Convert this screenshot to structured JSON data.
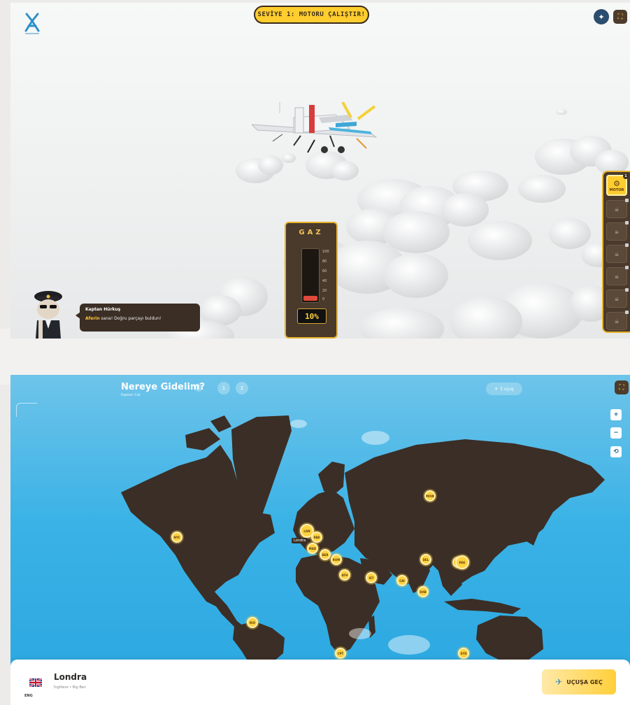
{
  "game": {
    "level_banner": "SEVİYE 1: MOTORU ÇALIŞTIR!",
    "throttle": {
      "label": "GAZ",
      "level": 0.1,
      "readout": "10%",
      "ticks": [
        "100",
        "80",
        "60",
        "40",
        "20",
        "0"
      ]
    },
    "parts_rail": {
      "active_label": "MOTOR",
      "active_badge": "1",
      "locked_count": 6
    },
    "pilot": {
      "name": "Kaptan Hürkuş",
      "message_highlight": "Aferin",
      "message_rest": " sana! Doğru parçayı buldun!"
    },
    "icons": {
      "top_right_round": "plus-icon",
      "top_right_square": "fullscreen-icon",
      "rail_active": "gear-icon",
      "rail_locked": "lock-icon"
    },
    "colors": {
      "accent": "#ffcd2e",
      "panel": "#4a3a2c",
      "throttle_fill": "#e04a3a"
    }
  },
  "map": {
    "title": "Nereye Gidelim?",
    "subtitle": "Kaptan Cat",
    "info_label": "i",
    "steps": [
      "1",
      "2"
    ],
    "plane_count": "3 uçuş",
    "zoom": {
      "in": "+",
      "out": "−",
      "reset": "⟲"
    },
    "selected_label": "Londra",
    "markers": [
      "LDN",
      "PAR",
      "ROM",
      "IST",
      "CAI",
      "DXB",
      "DEL",
      "BKK",
      "PEK",
      "TYO",
      "MOW",
      "NYC",
      "RIO",
      "CPT",
      "SYD",
      "MAD",
      "BER",
      "ATH"
    ],
    "destination": {
      "name": "Londra",
      "description": "İngiltere • Big Ben",
      "code": "ENG",
      "go_button": "UÇUŞA GEÇ"
    },
    "colors": {
      "ocean": "#2aa6e0",
      "land": "#3b2e26",
      "marker": "#ffd23f"
    }
  }
}
